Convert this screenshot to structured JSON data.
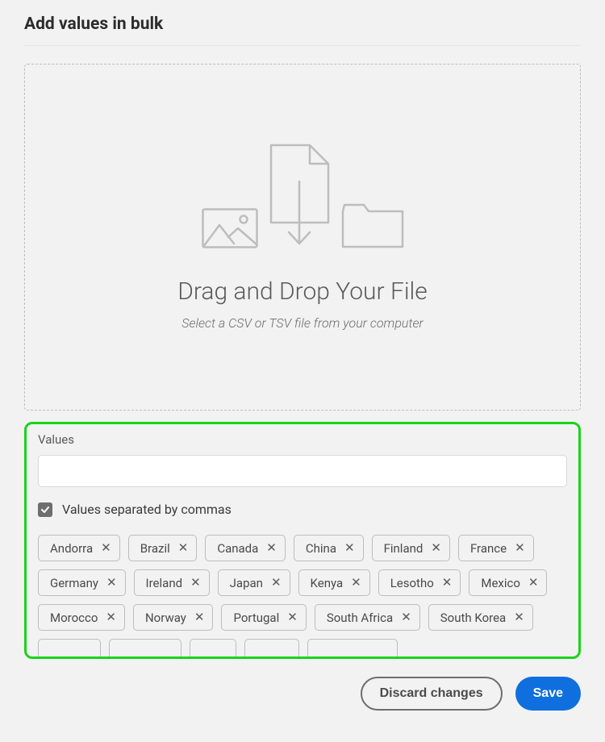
{
  "title": "Add values in bulk",
  "dropzone": {
    "title": "Drag and Drop Your File",
    "subtitle": "Select a CSV or TSV file from your computer"
  },
  "values": {
    "label": "Values",
    "input_value": "",
    "checkbox_checked": true,
    "checkbox_label": "Values separated by commas",
    "tags": [
      "Andorra",
      "Brazil",
      "Canada",
      "China",
      "Finland",
      "France",
      "Germany",
      "Ireland",
      "Japan",
      "Kenya",
      "Lesotho",
      "Mexico",
      "Morocco",
      "Norway",
      "Portugal",
      "South Africa",
      "South Korea"
    ],
    "partial_tags_count": 5
  },
  "footer": {
    "discard": "Discard changes",
    "save": "Save"
  }
}
